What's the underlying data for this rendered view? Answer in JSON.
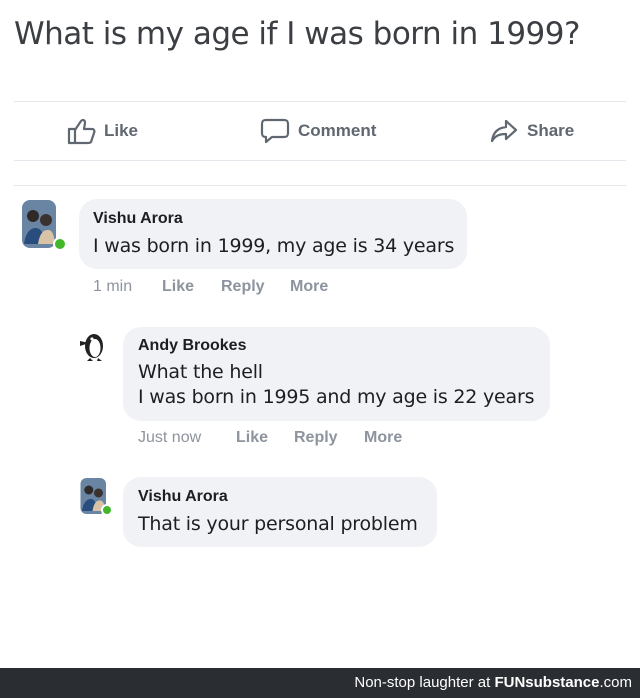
{
  "post": {
    "title": "What is my age if I was born in 1999?"
  },
  "actions": {
    "like": "Like",
    "comment": "Comment",
    "share": "Share"
  },
  "comments": [
    {
      "author": "Vishu Arora",
      "lines": [
        "I was born in 1999, my age is 34 years"
      ],
      "time": "1 min",
      "like": "Like",
      "reply": "Reply",
      "more": "More"
    },
    {
      "author": "Andy Brookes",
      "lines": [
        "What the hell",
        "I was born in 1995 and my age is 22 years"
      ],
      "time": "Just now",
      "like": "Like",
      "reply": "Reply",
      "more": "More"
    },
    {
      "author": "Vishu Arora",
      "lines": [
        "That is your personal problem"
      ]
    }
  ],
  "footer": {
    "prefix": "Non-stop laughter at ",
    "brand": "FUNsubstance",
    "suffix": ".com"
  },
  "colors": {
    "online": "#42b72a",
    "bubble": "#f0f2f5",
    "footer_bg": "#2a2d31"
  }
}
